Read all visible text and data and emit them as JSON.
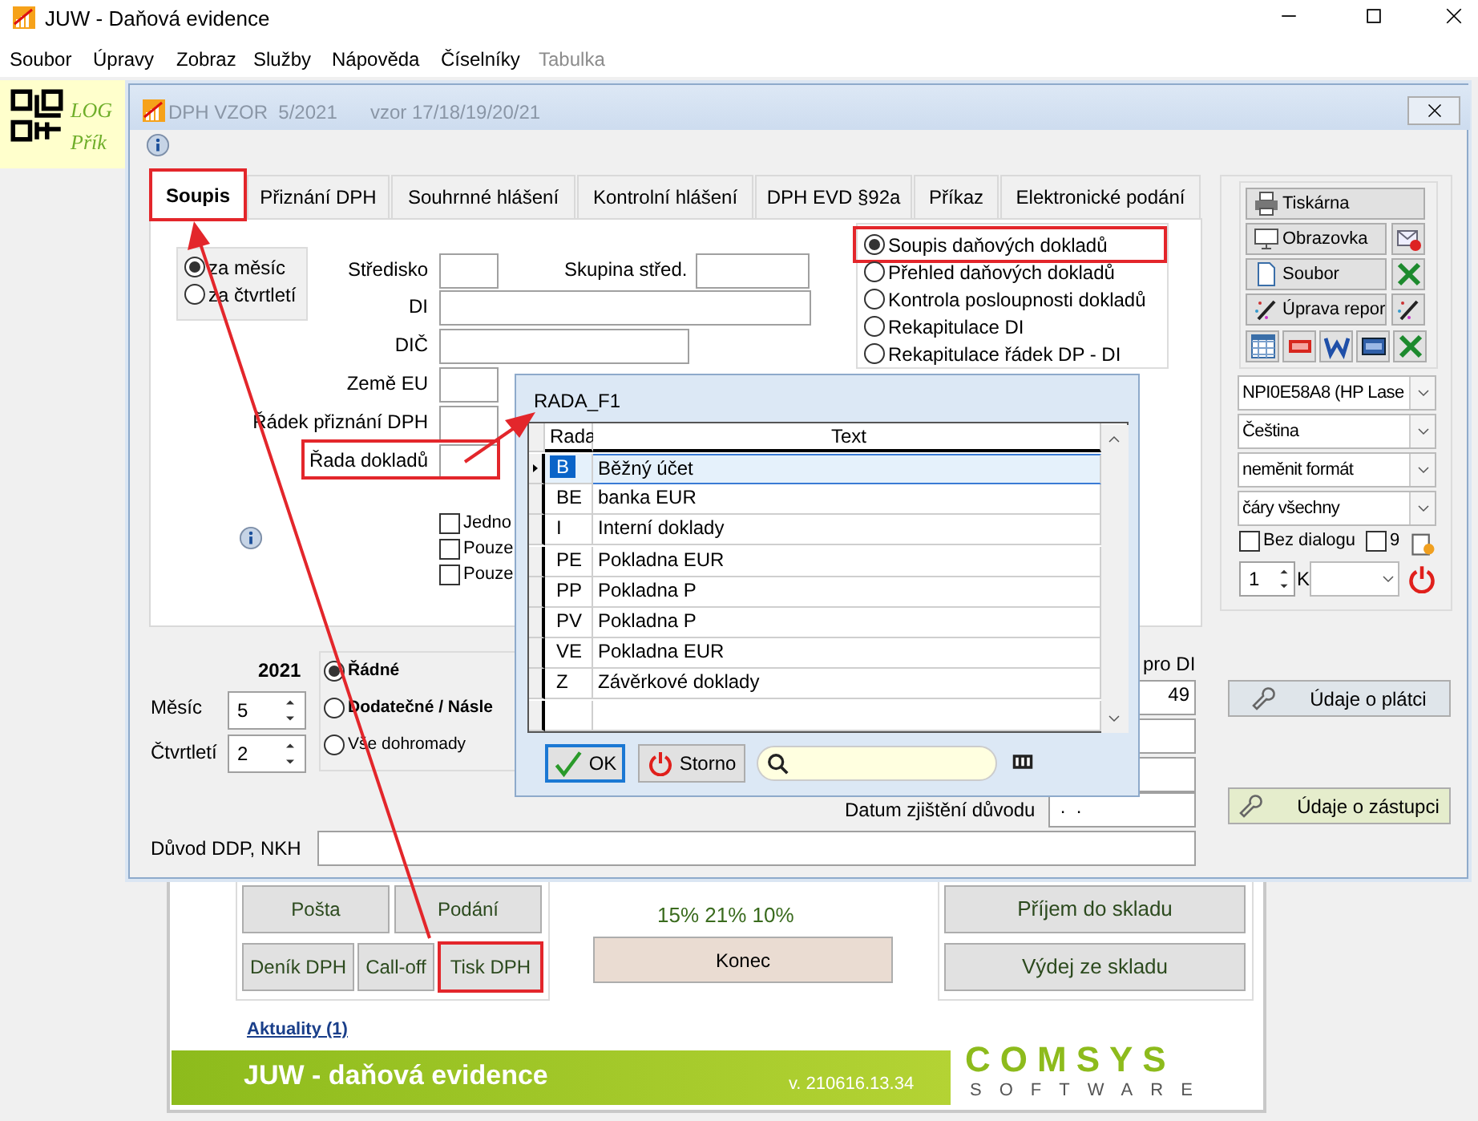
{
  "app_window": {
    "title": "JUW - Daňová evidence"
  },
  "menu": [
    {
      "label": "Soubor",
      "disabled": false
    },
    {
      "label": "Úpravy",
      "disabled": false
    },
    {
      "label": "Zobraz",
      "disabled": false
    },
    {
      "label": "Služby",
      "disabled": false
    },
    {
      "label": "Nápověda",
      "disabled": false
    },
    {
      "label": "Číselníky",
      "disabled": false
    },
    {
      "label": "Tabulka",
      "disabled": true
    }
  ],
  "banner": {
    "lines": [
      "LOG",
      "Přík"
    ]
  },
  "main_panel": {
    "left_buttons": [
      {
        "label": "Pošta",
        "highlighted": false
      },
      {
        "label": "Podání",
        "highlighted": false
      },
      {
        "label": "Deník DPH",
        "highlighted": false
      },
      {
        "label": "Call-off",
        "highlighted": false
      },
      {
        "label": "Tisk DPH",
        "highlighted": true
      }
    ],
    "rates": "15% 21% 10%",
    "exit_button": "Konec",
    "right_buttons": [
      "Příjem do skladu",
      "Výdej ze skladu"
    ],
    "news_link": "Aktuality (1)",
    "footer_title": "JUW - daňová evidence",
    "version": "v. 210616.13.34",
    "logo": [
      "COMSYS",
      "SOFTWARE"
    ]
  },
  "vat_dialog": {
    "title": "DPH VZOR  5/2021",
    "subtitle": "vzor 17/18/19/20/21",
    "tabs": [
      {
        "label": "Soupis",
        "selected": true,
        "highlighted": true
      },
      {
        "label": "Přiznání DPH",
        "selected": false,
        "highlighted": false
      },
      {
        "label": "Souhrnné hlášení",
        "selected": false,
        "highlighted": false
      },
      {
        "label": "Kontrolní hlášení",
        "selected": false,
        "highlighted": false
      },
      {
        "label": "DPH EVD §92a",
        "selected": false,
        "highlighted": false
      },
      {
        "label": "Příkaz",
        "selected": false,
        "highlighted": false
      },
      {
        "label": "Elektronické podání",
        "selected": false,
        "highlighted": false
      }
    ],
    "period": [
      {
        "label": "za měsíc",
        "selected": true
      },
      {
        "label": "za čtvrtletí",
        "selected": false
      }
    ],
    "fields": [
      {
        "label": "Středisko",
        "highlighted": false
      },
      {
        "label": "DI",
        "highlighted": false
      },
      {
        "label": "DIČ",
        "highlighted": false
      },
      {
        "label": "Země EU",
        "highlighted": false
      },
      {
        "label": "Řádek přiznání DPH",
        "highlighted": false
      },
      {
        "label": "Řada dokladů",
        "highlighted": true
      }
    ],
    "group_field": {
      "label": "Skupina střed."
    },
    "report_types": [
      {
        "label": "Soupis daňových dokladů",
        "selected": true,
        "highlighted": true
      },
      {
        "label": "Přehled daňových dokladů",
        "selected": false,
        "highlighted": false
      },
      {
        "label": "Kontrola posloupnosti dokladů",
        "selected": false,
        "highlighted": false
      },
      {
        "label": "Rekapitulace DI",
        "selected": false,
        "highlighted": false
      },
      {
        "label": "Rekapitulace řádek DP - DI",
        "selected": false,
        "highlighted": false
      }
    ],
    "options": [
      {
        "label": "Jedno",
        "checked": false
      },
      {
        "label": "Pouze",
        "checked": false
      },
      {
        "label": "Pouze",
        "checked": false
      }
    ],
    "year": "2021",
    "month": {
      "label": "Měsíc",
      "value": "5"
    },
    "quarter": {
      "label": "Čtvrtletí",
      "value": "2"
    },
    "filing": [
      {
        "label": "Řádné",
        "selected": true
      },
      {
        "label": "Dodatečné / Násle",
        "selected": false
      },
      {
        "label": "Vše dohromady",
        "selected": false
      }
    ],
    "di_label": "pro DI",
    "di_value": "49",
    "date_field": {
      "label": "Datum zjištění důvodu",
      "value": " .  ."
    },
    "reason": {
      "label": "Důvod DDP, NKH"
    },
    "output_buttons": [
      {
        "label": "Tiskárna",
        "kind": "printer"
      },
      {
        "label": "Obrazovka",
        "kind": "screen"
      },
      {
        "label": "Soubor",
        "kind": "file"
      },
      {
        "label": "Úprava repor",
        "kind": "wand"
      }
    ],
    "selects": [
      "NPI0E58A8 (HP Lase",
      "Čeština",
      "neměnit formát",
      "čáry všechny"
    ],
    "no_dialog": {
      "label": "Bez dialogu",
      "checked": false
    },
    "nine": {
      "label": "9",
      "checked": false
    },
    "copies": "1",
    "copies_label": "K",
    "payer_button": "Údaje o plátci",
    "agent_button": "Údaje o zástupci"
  },
  "rada_dialog": {
    "title": "RADA_F1",
    "columns": [
      "Rada",
      "Text"
    ],
    "rows": [
      {
        "code": "B",
        "text": "Běžný účet",
        "selected": true
      },
      {
        "code": "BE",
        "text": "banka EUR",
        "selected": false
      },
      {
        "code": "I",
        "text": "Interní doklady",
        "selected": false
      },
      {
        "code": "PE",
        "text": "Pokladna EUR",
        "selected": false
      },
      {
        "code": "PP",
        "text": "Pokladna P",
        "selected": false
      },
      {
        "code": "PV",
        "text": "Pokladna P",
        "selected": false
      },
      {
        "code": "VE",
        "text": "Pokladna EUR",
        "selected": false
      },
      {
        "code": "Z",
        "text": "Závěrkové doklady",
        "selected": false
      }
    ],
    "ok": "OK",
    "cancel": "Storno"
  }
}
